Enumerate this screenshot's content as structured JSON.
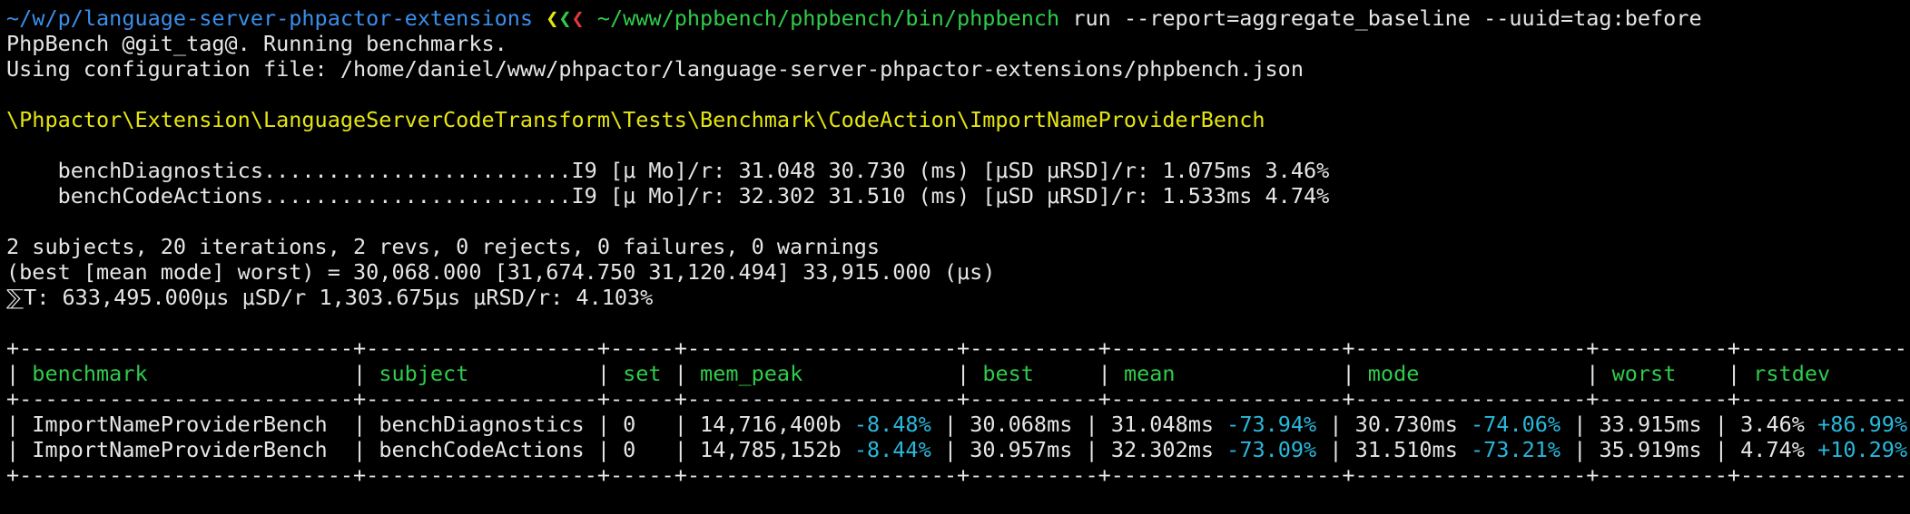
{
  "colors": {
    "background": "#000000",
    "text": "#e6e6e6",
    "path": "#3b8eea",
    "command": "#2fcc4a",
    "namespace": "#e5e510",
    "diff": "#29b8db",
    "prompt_chevron_1": "#e5e510",
    "prompt_chevron_2": "#2fcc4a",
    "prompt_chevron_3": "#e0383b"
  },
  "prompt": {
    "cwd": "~/w/p/language-server-phpactor-extensions",
    "chevrons": [
      "❮",
      "❮",
      "❮"
    ],
    "command": "~/www/phpbench/phpbench/bin/phpbench",
    "args": "run --report=aggregate_baseline --uuid=tag:before"
  },
  "output": {
    "intro_1": "PhpBench @git_tag@. Running benchmarks.",
    "intro_2": "Using configuration file: /home/daniel/www/phpactor/language-server-phpactor-extensions/phpbench.json",
    "class_name": "\\Phpactor\\Extension\\LanguageServerCodeTransform\\Tests\\Benchmark\\CodeAction\\ImportNameProviderBench",
    "subjects": [
      "    benchDiagnostics........................I9 [μ Mo]/r: 31.048 30.730 (ms) [μSD μRSD]/r: 1.075ms 3.46%",
      "    benchCodeActions........................I9 [μ Mo]/r: 32.302 31.510 (ms) [μSD μRSD]/r: 1.533ms 4.74%"
    ],
    "summary": [
      "2 subjects, 20 iterations, 2 revs, 0 rejects, 0 failures, 0 warnings",
      "(best [mean mode] worst) = 30,068.000 [31,674.750 31,120.494] 33,915.000 (μs)",
      "⅀T: 633,495.000μs μSD/r 1,303.675μs μRSD/r: 4.103%"
    ]
  },
  "table": {
    "border": "+--------------------------+------------------+-----+---------------------+----------+------------------+------------------+----------+--------------+",
    "headers": [
      "benchmark",
      "subject",
      "set",
      "mem_peak",
      "best",
      "mean",
      "mode",
      "worst",
      "rstdev"
    ],
    "rows": [
      {
        "benchmark": "ImportNameProviderBench",
        "subject": "benchDiagnostics",
        "set": "0",
        "mem_peak": "14,716,400b",
        "mem_peak_diff": "-8.48%",
        "best": "30.068ms",
        "mean": "31.048ms",
        "mean_diff": "-73.94%",
        "mode": "30.730ms",
        "mode_diff": "-74.06%",
        "worst": "33.915ms",
        "rstdev": "3.46%",
        "rstdev_diff": "+86.99%"
      },
      {
        "benchmark": "ImportNameProviderBench",
        "subject": "benchCodeActions",
        "set": "0",
        "mem_peak": "14,785,152b",
        "mem_peak_diff": "-8.44%",
        "best": "30.957ms",
        "mean": "32.302ms",
        "mean_diff": "-73.09%",
        "mode": "31.510ms",
        "mode_diff": "-73.21%",
        "worst": "35.919ms",
        "rstdev": "4.74%",
        "rstdev_diff": "+10.29%"
      }
    ]
  }
}
